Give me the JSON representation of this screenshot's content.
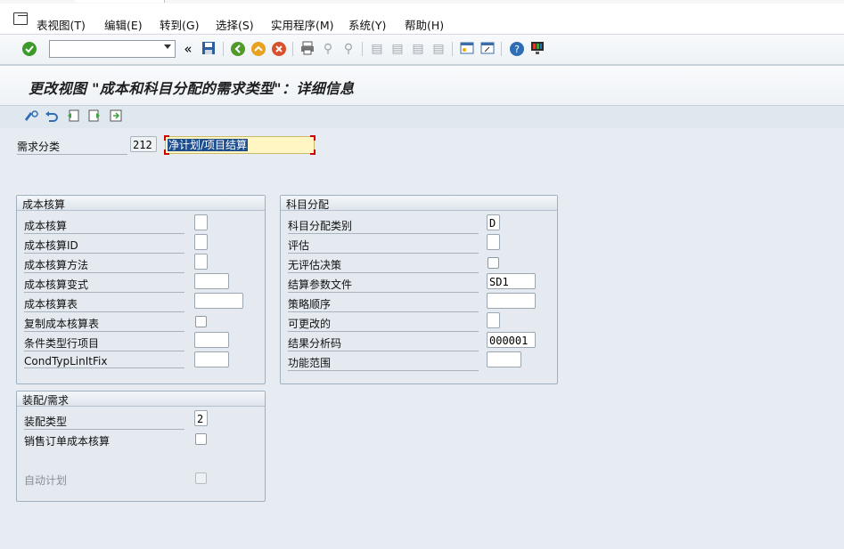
{
  "menu": {
    "items": [
      "表视图(T)",
      "编辑(E)",
      "转到(G)",
      "选择(S)",
      "实用程序(M)",
      "系统(Y)",
      "帮助(H)"
    ]
  },
  "toolbar": {
    "command_field_value": "",
    "icons": [
      "enter-check-icon",
      "back-icon",
      "exit-icon",
      "cancel-icon",
      "print-icon",
      "find-icon",
      "find-next-icon",
      "first-page-icon",
      "prev-page-icon",
      "next-page-icon",
      "last-page-icon",
      "new-session-icon",
      "shortcut-icon",
      "help-icon",
      "layout-icon"
    ]
  },
  "title": "更改视图 \"成本和科目分配的需求类型\"：详细信息",
  "header": {
    "category_label": "需求分类",
    "category_code": "212",
    "category_desc": "净计划/项目结算"
  },
  "groups": {
    "costing": {
      "title": "成本核算",
      "fields": [
        {
          "label": "成本核算",
          "value": ""
        },
        {
          "label": "成本核算ID",
          "value": ""
        },
        {
          "label": "成本核算方法",
          "value": ""
        },
        {
          "label": "成本核算变式",
          "value": ""
        },
        {
          "label": "成本核算表",
          "value": ""
        },
        {
          "label": "复制成本核算表",
          "value": ""
        },
        {
          "label": "条件类型行项目",
          "value": ""
        },
        {
          "label": "CondTypLinItFix",
          "value": ""
        }
      ]
    },
    "acct": {
      "title": "科目分配",
      "fields": [
        {
          "label": "科目分配类别",
          "value": "D"
        },
        {
          "label": "评估",
          "value": ""
        },
        {
          "label": "无评估决策",
          "value": ""
        },
        {
          "label": "结算参数文件",
          "value": "SD1"
        },
        {
          "label": "策略顺序",
          "value": ""
        },
        {
          "label": "可更改的",
          "value": ""
        },
        {
          "label": "结果分析码",
          "value": "000001"
        },
        {
          "label": "功能范围",
          "value": ""
        }
      ]
    },
    "assembly": {
      "title": "装配/需求",
      "fields": [
        {
          "label": "装配类型",
          "value": "2"
        },
        {
          "label": "销售订单成本核算",
          "value": ""
        },
        {
          "label": "自动计划",
          "value": ""
        }
      ]
    }
  },
  "colors": {
    "accent": "#1f4e8e",
    "highlight": "#fff6c4",
    "background": "#e6ecf1"
  }
}
